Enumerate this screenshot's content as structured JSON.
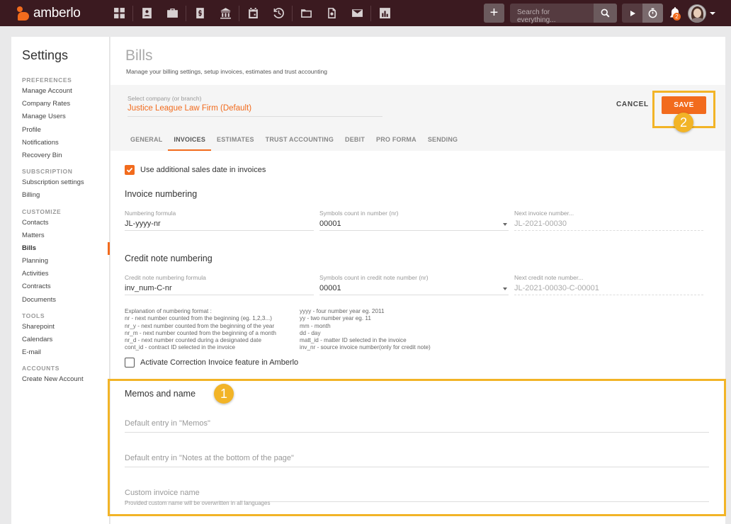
{
  "app": {
    "logo_text": "amberlo"
  },
  "topbar": {
    "nav_icons": [
      "dashboard-icon",
      "contacts-icon",
      "matters-icon",
      "bills-icon",
      "bank-icon",
      "calendar-icon",
      "history-icon",
      "folder-icon",
      "document-settings-icon",
      "mail-icon",
      "reports-icon"
    ],
    "search_placeholder": "Search for everything...",
    "notifications_count": "2"
  },
  "sidebar": {
    "title": "Settings",
    "groups": [
      {
        "label": "PREFERENCES",
        "items": [
          "Manage Account",
          "Company Rates",
          "Manage Users",
          "Profile",
          "Notifications",
          "Recovery Bin"
        ]
      },
      {
        "label": "SUBSCRIPTION",
        "items": [
          "Subscription settings",
          "Billing"
        ]
      },
      {
        "label": "CUSTOMIZE",
        "items": [
          "Contacts",
          "Matters",
          "Bills",
          "Planning",
          "Activities",
          "Contracts",
          "Documents"
        ]
      },
      {
        "label": "TOOLS",
        "items": [
          "Sharepoint",
          "Calendars",
          "E-mail"
        ]
      },
      {
        "label": "ACCOUNTS",
        "items": [
          "Create New Account"
        ]
      }
    ],
    "active_item": "Bills"
  },
  "main": {
    "title": "Bills",
    "subtitle": "Manage your billing settings, setup invoices, estimates and trust accounting",
    "company_label": "Select company (or branch)",
    "company_value": "Justice League Law Firm (Default)",
    "cancel_label": "CANCEL",
    "save_label": "SAVE",
    "tabs": [
      "GENERAL",
      "INVOICES",
      "ESTIMATES",
      "TRUST ACCOUNTING",
      "DEBIT",
      "PRO FORMA",
      "SENDING"
    ],
    "active_tab": "INVOICES",
    "use_sales_date_label": "Use additional sales date in invoices",
    "use_sales_date_checked": true,
    "invoice_numbering": {
      "title": "Invoice numbering",
      "formula_label": "Numbering formula",
      "formula_value": "JL-yyyy-nr",
      "symbols_label": "Symbols count in number (nr)",
      "symbols_value": "00001",
      "next_label": "Next invoice number...",
      "next_value": "JL-2021-00030"
    },
    "credit_numbering": {
      "title": "Credit note numbering",
      "formula_label": "Credit note numbering formula",
      "formula_value": "inv_num-C-nr",
      "symbols_label": "Symbols count in credit note number (nr)",
      "symbols_value": "00001",
      "next_label": "Next credit note number...",
      "next_value": "JL-2021-00030-C-00001"
    },
    "explanation_left": "Explanation of numbering format :\nnr - next number counted from the beginning (eg. 1,2,3...)\nnr_y - next number counted from the beginning of the year\nnr_m - next number counted from the beginning of a month\nnr_d - next number counted during a designated date\ncont_id - contract ID selected in the invoice",
    "explanation_right": "yyyy - four number year eg. 2011\nyy - two number year eg. 11\nmm - month\ndd - day\nmatt_id - matter ID selected in the invoice\ninv_nr - source invoice number(only for credit note)",
    "correction_label": "Activate Correction Invoice feature in Amberlo",
    "correction_checked": false,
    "memos": {
      "title": "Memos and name",
      "memos_placeholder": "Default entry in \"Memos\"",
      "notes_placeholder": "Default entry in \"Notes at the bottom of the page\"",
      "custom_name_placeholder": "Custom invoice name",
      "custom_name_hint": "Provided custom name will be overwritten in all languages"
    }
  },
  "callouts": {
    "memos_number": "1",
    "save_number": "2",
    "color": "#f2b427"
  },
  "colors": {
    "accent": "#f26b1d",
    "topbar": "#3b1a20"
  }
}
